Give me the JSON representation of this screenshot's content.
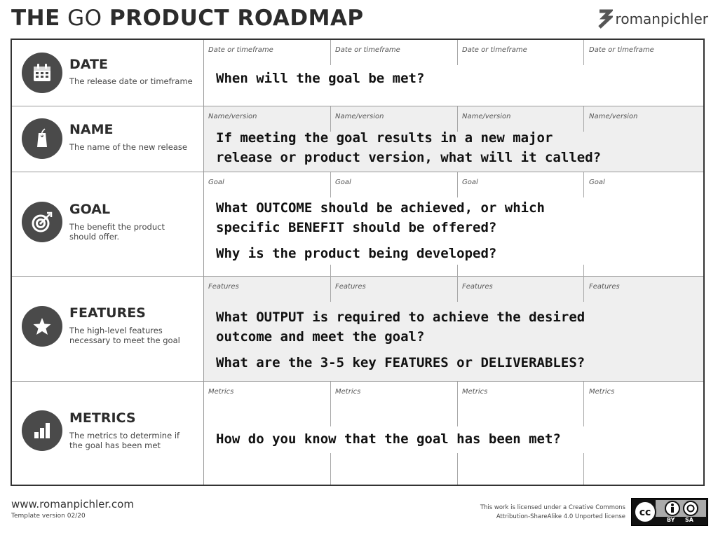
{
  "header": {
    "title_part1": "THE",
    "title_part2": "GO",
    "title_part3": "PRODUCT ROADMAP",
    "brand": "romanpichler"
  },
  "rows": [
    {
      "title": "DATE",
      "description": "The release date or timeframe",
      "icon": "calendar-icon",
      "column_label": "Date or timeframe",
      "prompts": [
        "When will the goal be met?"
      ]
    },
    {
      "title": "NAME",
      "description": "The name of the new release",
      "icon": "tag-icon",
      "column_label": "Name/version",
      "prompts": [
        "If meeting the goal results in a new major",
        "release or product version, what will it called?"
      ]
    },
    {
      "title": "GOAL",
      "description": "The benefit the product should offer.",
      "icon": "target-icon",
      "column_label": "Goal",
      "prompts": [
        "What OUTCOME should be achieved, or which",
        "specific BENEFIT should be offered?",
        "Why is the product being developed?"
      ]
    },
    {
      "title": "FEATURES",
      "description": "The high-level features necessary to meet the goal",
      "icon": "star-icon",
      "column_label": "Features",
      "prompts": [
        "What OUTPUT is required to achieve the desired",
        "outcome and meet the goal?",
        "What are the 3-5 key FEATURES or DELIVERABLES?"
      ]
    },
    {
      "title": "METRICS",
      "description": "The metrics to determine if the goal has been met",
      "icon": "bar-chart-icon",
      "column_label": "Metrics",
      "prompts": [
        "How do you know that the goal has been met?"
      ]
    }
  ],
  "footer": {
    "url": "www.romanpichler.com",
    "version": "Template version 02/20",
    "license_line1": "This work is licensed under a Creative Commons",
    "license_line2": "Attribution-ShareAlike 4.0 Unported license",
    "cc_by": "BY",
    "cc_sa": "SA"
  }
}
